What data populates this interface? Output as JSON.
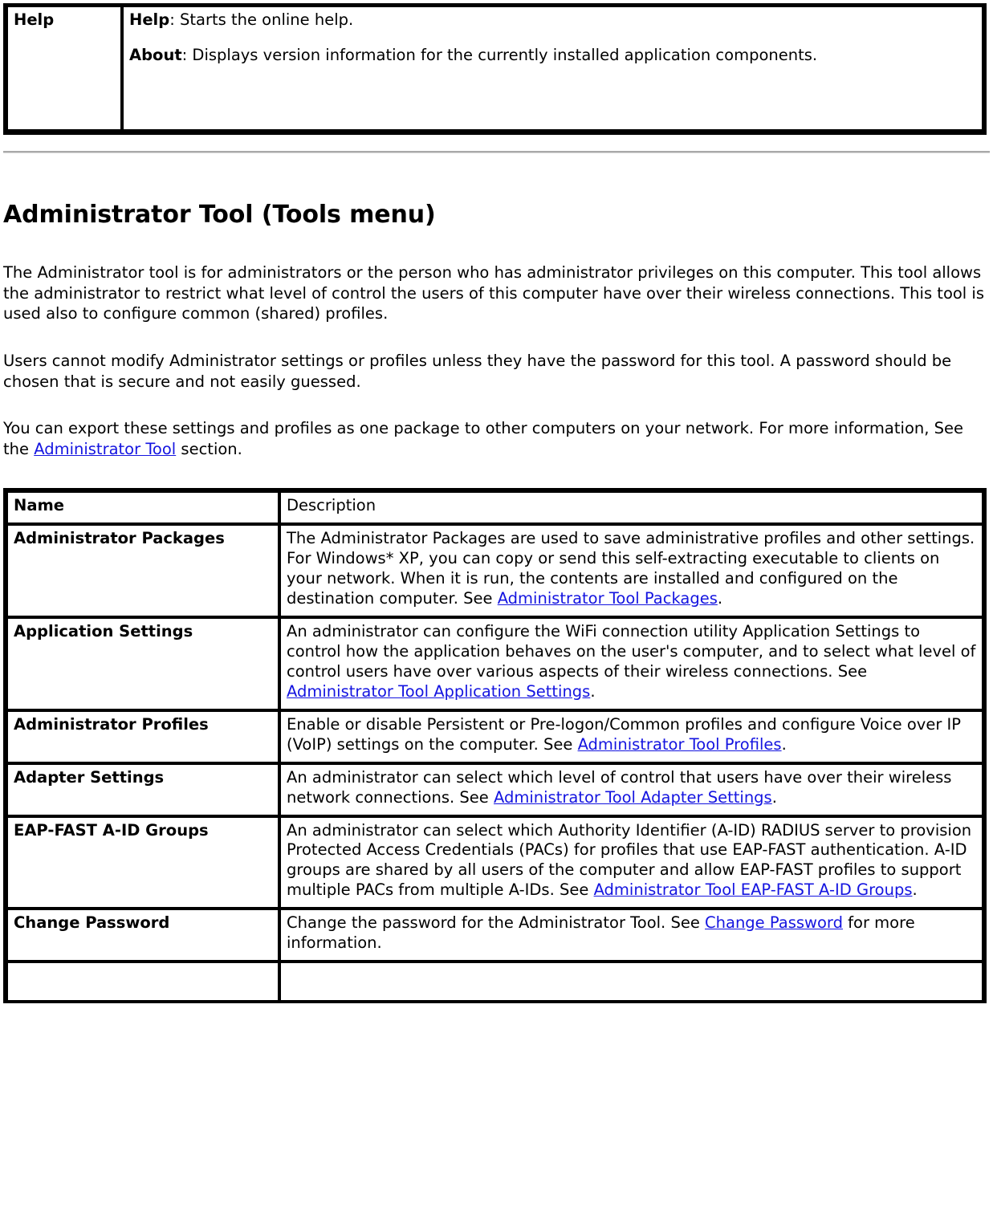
{
  "colors": {
    "link": "#1414e0",
    "text": "#000000",
    "rule": "#a9a9a9",
    "border": "#000000",
    "background": "#ffffff"
  },
  "top_table": {
    "row": {
      "name": "Help",
      "line1_label": "Help",
      "line1_text": ": Starts the online help.",
      "line2_label": "About",
      "line2_text": ": Displays version information for the currently installed application components."
    }
  },
  "heading": "Administrator Tool (Tools menu)",
  "paragraphs": [
    {
      "id": "intro",
      "text": "The Administrator tool is for administrators or the person who has administrator privileges on this computer. This tool allows the administrator to restrict what level of control the users of this computer have over their wireless connections. This tool is used also to configure common (shared) profiles."
    },
    {
      "id": "password-note",
      "text": "Users cannot modify Administrator settings or profiles unless they have the password for this tool. A password should be chosen that is secure and not easily guessed."
    },
    {
      "id": "export-note",
      "before": "You can export these settings and profiles as one package to other computers on your network. For more information, See the ",
      "link": "Administrator Tool",
      "after": " section."
    }
  ],
  "main_table": {
    "headers": {
      "name": "Name",
      "description": "Description"
    },
    "rows": [
      {
        "name": "Administrator Packages",
        "before": "The Administrator Packages are used to save administrative profiles and other settings. For Windows* XP, you can copy or send this self-extracting executable to clients on your network. When it is run, the contents are installed and configured on the destination computer. See ",
        "link": "Administrator Tool Packages",
        "after": "."
      },
      {
        "name": "Application Settings",
        "before": "An administrator can configure the WiFi connection utility Application Settings to control how the application behaves on the user's computer, and to select what level of control users have over various aspects of their wireless connections. See ",
        "link": "Administrator Tool Application Settings",
        "after": "."
      },
      {
        "name": "Administrator Profiles",
        "before": "Enable or disable Persistent or Pre-logon/Common profiles and configure Voice over IP (VoIP) settings on the computer. See ",
        "link": "Administrator Tool Profiles",
        "after": "."
      },
      {
        "name": "Adapter Settings",
        "before": "An administrator can select which level of control that users have over their wireless network connections. See ",
        "link": "Administrator Tool Adapter Settings",
        "after": "."
      },
      {
        "name": "EAP-FAST A-ID Groups",
        "before": "An administrator can select which Authority Identifier (A-ID) RADIUS server to provision Protected Access Credentials (PACs) for profiles that use EAP-FAST authentication. A-ID groups are shared by all users of the computer and allow EAP-FAST profiles to support multiple PACs from multiple A-IDs. See ",
        "link": "Administrator Tool EAP-FAST A-ID Groups",
        "after": "."
      },
      {
        "name": "Change Password",
        "before": "Change the password for the Administrator Tool. See ",
        "link": "Change Password",
        "after": " for more information."
      }
    ]
  }
}
